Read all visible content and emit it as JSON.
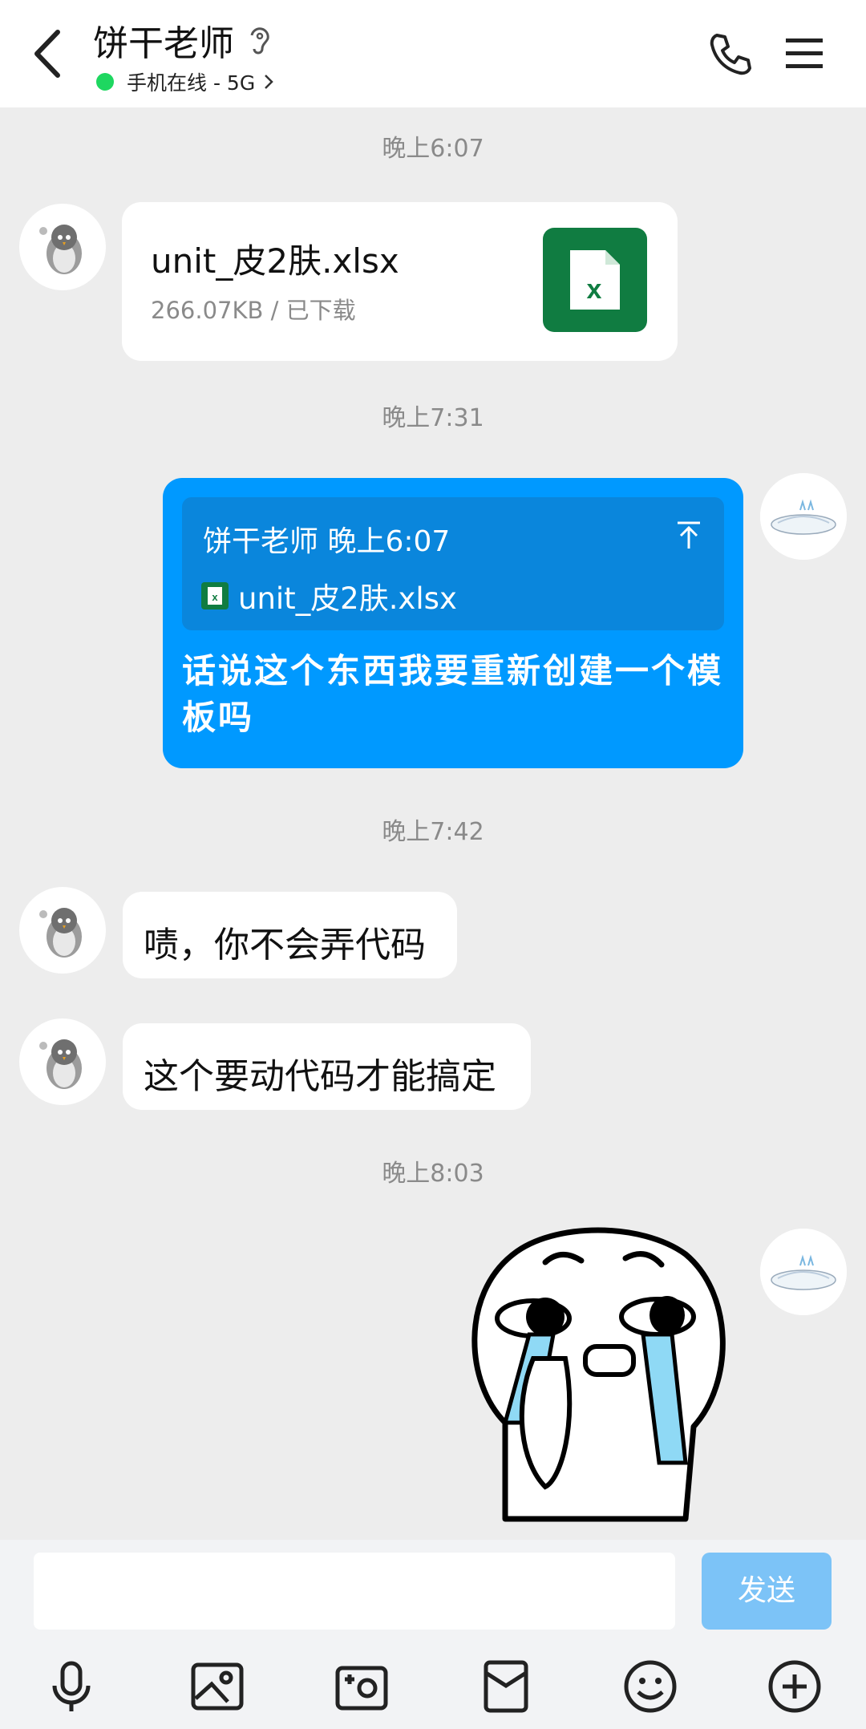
{
  "header": {
    "title": "饼干老师",
    "status_text": "手机在线 - 5G"
  },
  "messages": {
    "ts1": "晚上6:07",
    "file_name": "unit_皮2肤.xlsx",
    "file_meta": "266.07KB / 已下载",
    "ts2": "晚上7:31",
    "quote_header": "饼干老师 晚上6:07",
    "quote_file": "unit_皮2肤.xlsx",
    "reply_text": "话说这个东西我要重新创建一个模板吗",
    "ts3": "晚上7:42",
    "msg1": "啧，你不会弄代码",
    "msg2": "这个要动代码才能搞定",
    "ts4": "晚上8:03"
  },
  "input": {
    "value": "",
    "send_label": "发送"
  },
  "colors": {
    "accent": "#0099ff",
    "online": "#1ed760",
    "excel": "#107c41"
  },
  "icons": [
    "back-icon",
    "ear-icon",
    "phone-icon",
    "menu-icon",
    "excel-icon",
    "pin-top-icon",
    "mic-icon",
    "image-icon",
    "camera-icon",
    "red-packet-icon",
    "emoji-icon",
    "plus-icon"
  ]
}
